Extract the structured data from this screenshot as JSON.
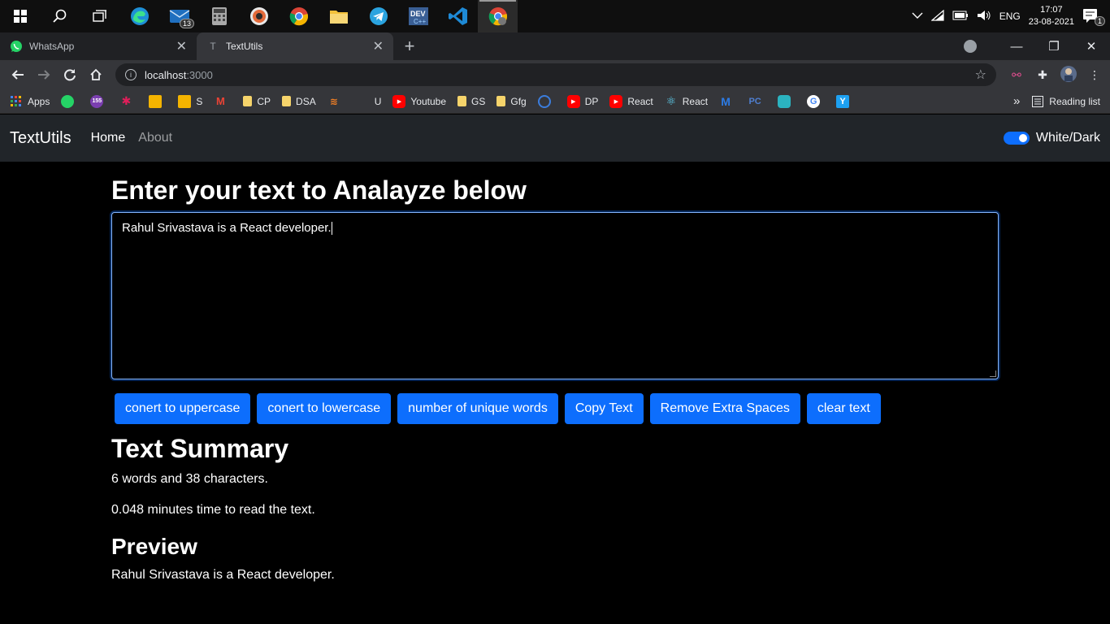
{
  "taskbar": {
    "mail_badge": "13",
    "language": "ENG",
    "time": "17:07",
    "date": "23-08-2021",
    "notification_count": "1"
  },
  "tabs": [
    {
      "title": "WhatsApp"
    },
    {
      "title": "TextUtils"
    }
  ],
  "address": {
    "host": "localhost",
    "port": ":3000"
  },
  "bookmarks": {
    "items": [
      {
        "label": "Apps"
      },
      {
        "label": ""
      },
      {
        "label": ""
      },
      {
        "label": ""
      },
      {
        "label": ""
      },
      {
        "label": "S"
      },
      {
        "label": ""
      },
      {
        "label": "CP"
      },
      {
        "label": "DSA"
      },
      {
        "label": ""
      },
      {
        "label": "U"
      },
      {
        "label": "Youtube"
      },
      {
        "label": "GS"
      },
      {
        "label": "Gfg"
      },
      {
        "label": ""
      },
      {
        "label": "DP"
      },
      {
        "label": "React"
      },
      {
        "label": "React"
      }
    ],
    "more": "»",
    "reading_list": "Reading list"
  },
  "app": {
    "brand": "TextUtils",
    "nav": {
      "home": "Home",
      "about": "About"
    },
    "mode_label": "White/Dark",
    "mode_enabled": true,
    "heading": "Enter your text to Analayze below",
    "text_value": "Rahul Srivastava is a React developer.",
    "buttons": {
      "upper": "conert to uppercase",
      "lower": "conert to lowercase",
      "unique": "number of unique words",
      "copy": "Copy Text",
      "spaces": "Remove Extra Spaces",
      "clear": "clear text"
    },
    "summary_heading": "Text Summary",
    "summary_counts": "6 words and 38 characters.",
    "read_time": "0.048 minutes time to read the text.",
    "preview_heading": "Preview",
    "preview_text": "Rahul Srivastava is a React developer."
  }
}
